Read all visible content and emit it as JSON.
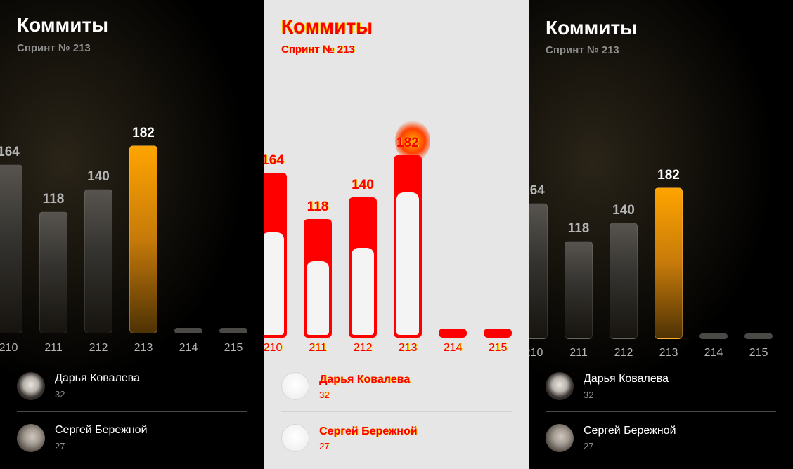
{
  "panels": [
    {
      "title": "Коммиты",
      "subtitle": "Спринт № 213"
    },
    {
      "title": "Коммиты",
      "subtitle": "Спринт № 213"
    },
    {
      "title": "Коммиты",
      "subtitle": "Спринт № 213"
    }
  ],
  "chart_data": {
    "type": "bar",
    "categories": [
      "210",
      "211",
      "212",
      "213",
      "214",
      "215"
    ],
    "values": [
      164,
      118,
      140,
      182,
      0,
      0
    ],
    "value_labels": [
      "164",
      "118",
      "140",
      "182",
      "",
      ""
    ],
    "active_category": "213",
    "active_color": "#ffa400"
  },
  "users": [
    {
      "name": "Дарья Ковалева",
      "count": "32",
      "avatar_icon": "female-avatar"
    },
    {
      "name": "Сергей Бережной",
      "count": "27",
      "avatar_icon": "male-avatar"
    }
  ],
  "colors": {
    "background": "#000000",
    "accent": "#ffa400",
    "diff_panel_background": "#e6e6e6",
    "diff_highlight": "#ff0000"
  }
}
